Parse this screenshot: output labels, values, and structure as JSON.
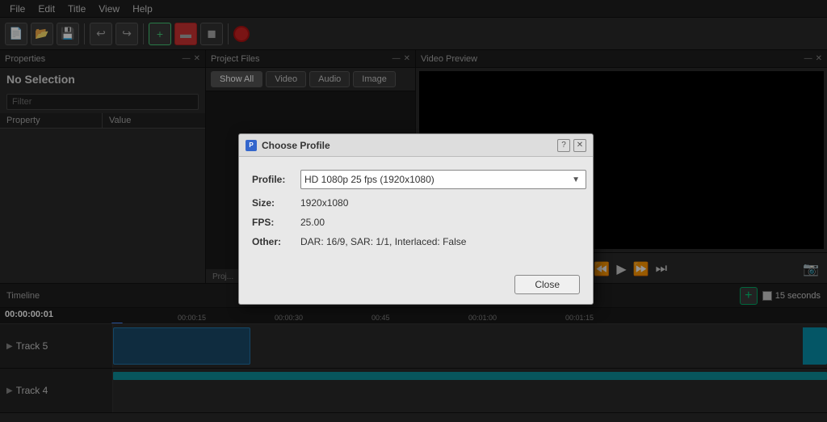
{
  "menubar": {
    "items": [
      "File",
      "Edit",
      "Title",
      "View",
      "Help"
    ]
  },
  "toolbar": {
    "buttons": [
      "new",
      "open",
      "save",
      "undo",
      "redo",
      "add-track",
      "transitions",
      "effects"
    ]
  },
  "properties_panel": {
    "header_label": "Properties",
    "title": "No Selection",
    "filter_placeholder": "Filter",
    "table_headers": [
      "Property",
      "Value"
    ]
  },
  "project_files": {
    "header_label": "Project Files",
    "tabs": [
      "Show All",
      "Video",
      "Audio",
      "Image"
    ]
  },
  "video_preview": {
    "header_label": "Video Preview"
  },
  "timeline": {
    "label": "Timeline",
    "timecode": "00:00:00:01",
    "add_track_label": "+",
    "seconds_label": "15 seconds",
    "ruler_marks": [
      "00:00:15",
      "00:00:30",
      "00:45",
      "00:01:00",
      "00:01:15"
    ],
    "tracks": [
      {
        "name": "Track 5",
        "id": "track5"
      },
      {
        "name": "Track 4",
        "id": "track4"
      }
    ]
  },
  "dialog": {
    "title": "Choose Profile",
    "icon_label": "P",
    "help_label": "?",
    "close_x_label": "✕",
    "profile_label": "Profile:",
    "profile_value": "HD 1080p 25 fps (1920x1080)",
    "size_label": "Size:",
    "size_value": "1920x1080",
    "fps_label": "FPS:",
    "fps_value": "25.00",
    "other_label": "Other:",
    "other_value": "DAR: 16/9, SAR: 1/1, Interlaced: False",
    "close_btn_label": "Close"
  }
}
